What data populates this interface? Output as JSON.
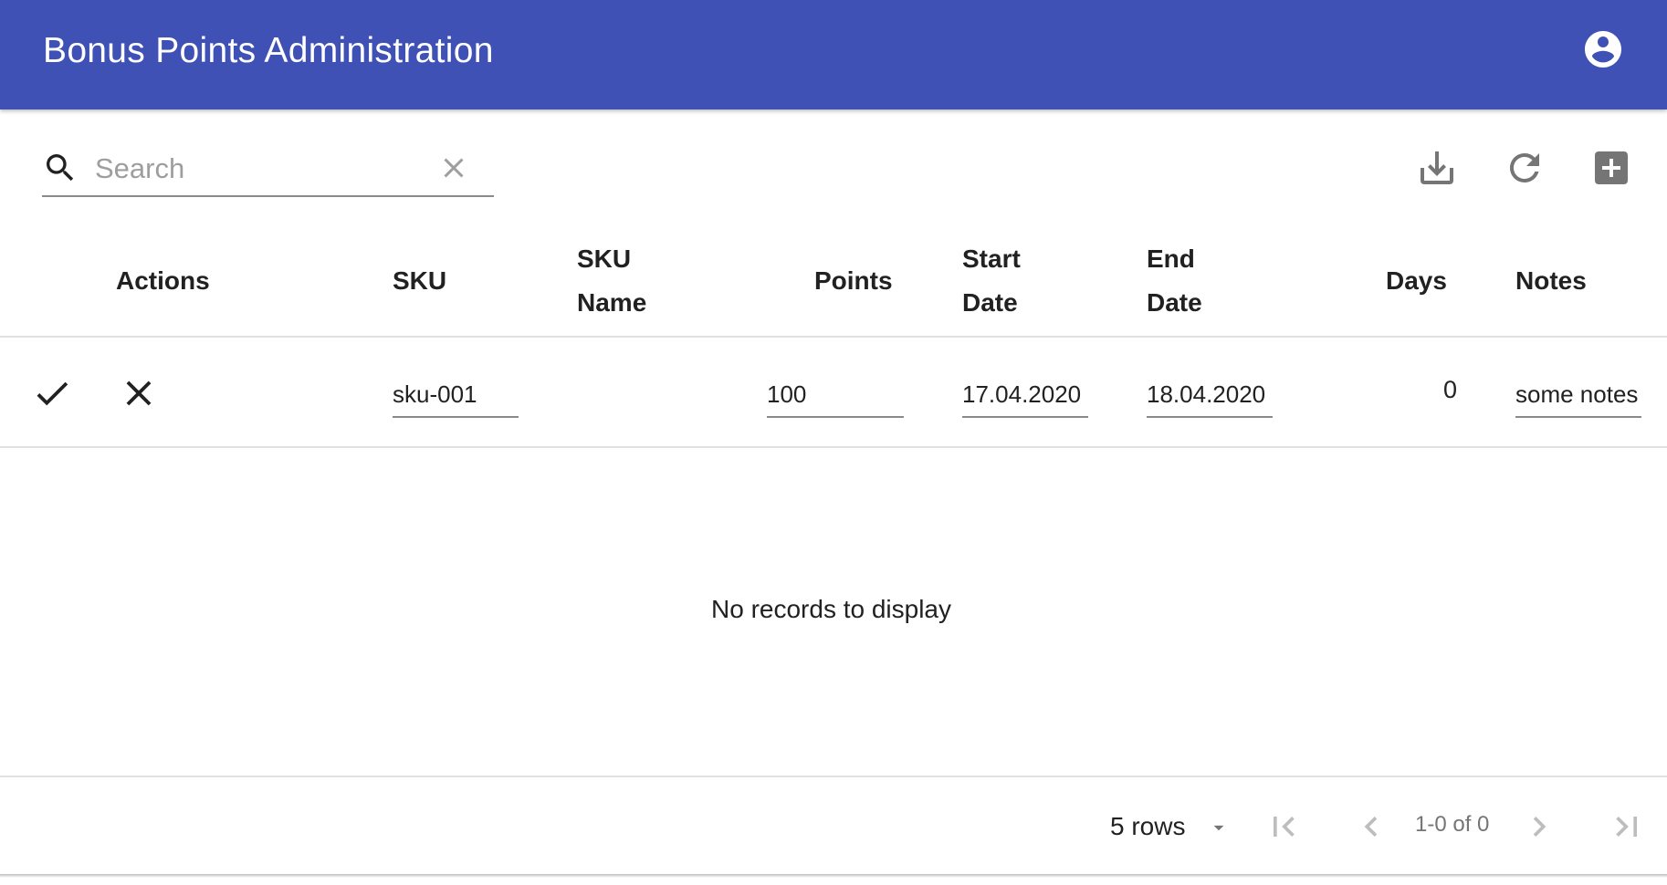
{
  "app": {
    "title": "Bonus Points Administration"
  },
  "colors": {
    "appbar": "#3f51b5",
    "icon": "#757575",
    "divider": "#e0e0e0"
  },
  "toolbar": {
    "search_placeholder": "Search",
    "search_value": "",
    "icons": [
      "search-icon",
      "clear-icon",
      "download-icon",
      "refresh-icon",
      "add-box-icon"
    ]
  },
  "table": {
    "columns": [
      {
        "key": "actions",
        "label": "Actions"
      },
      {
        "key": "sku",
        "label": "SKU"
      },
      {
        "key": "sku_name",
        "label_line1": "SKU",
        "label_line2": "Name"
      },
      {
        "key": "points",
        "label": "Points"
      },
      {
        "key": "start_date",
        "label_line1": "Start",
        "label_line2": "Date"
      },
      {
        "key": "end_date",
        "label_line1": "End",
        "label_line2": "Date"
      },
      {
        "key": "days",
        "label": "Days"
      },
      {
        "key": "notes",
        "label": "Notes"
      }
    ],
    "edit_row": {
      "sku": "sku-001",
      "sku_name": "",
      "points": "100",
      "start_date": "17.04.2020",
      "end_date": "18.04.2020",
      "days": "0",
      "notes": "some notes"
    },
    "empty_message": "No records to display"
  },
  "pagination": {
    "rows_label": "5 rows",
    "page_info": "1-0 of 0"
  }
}
